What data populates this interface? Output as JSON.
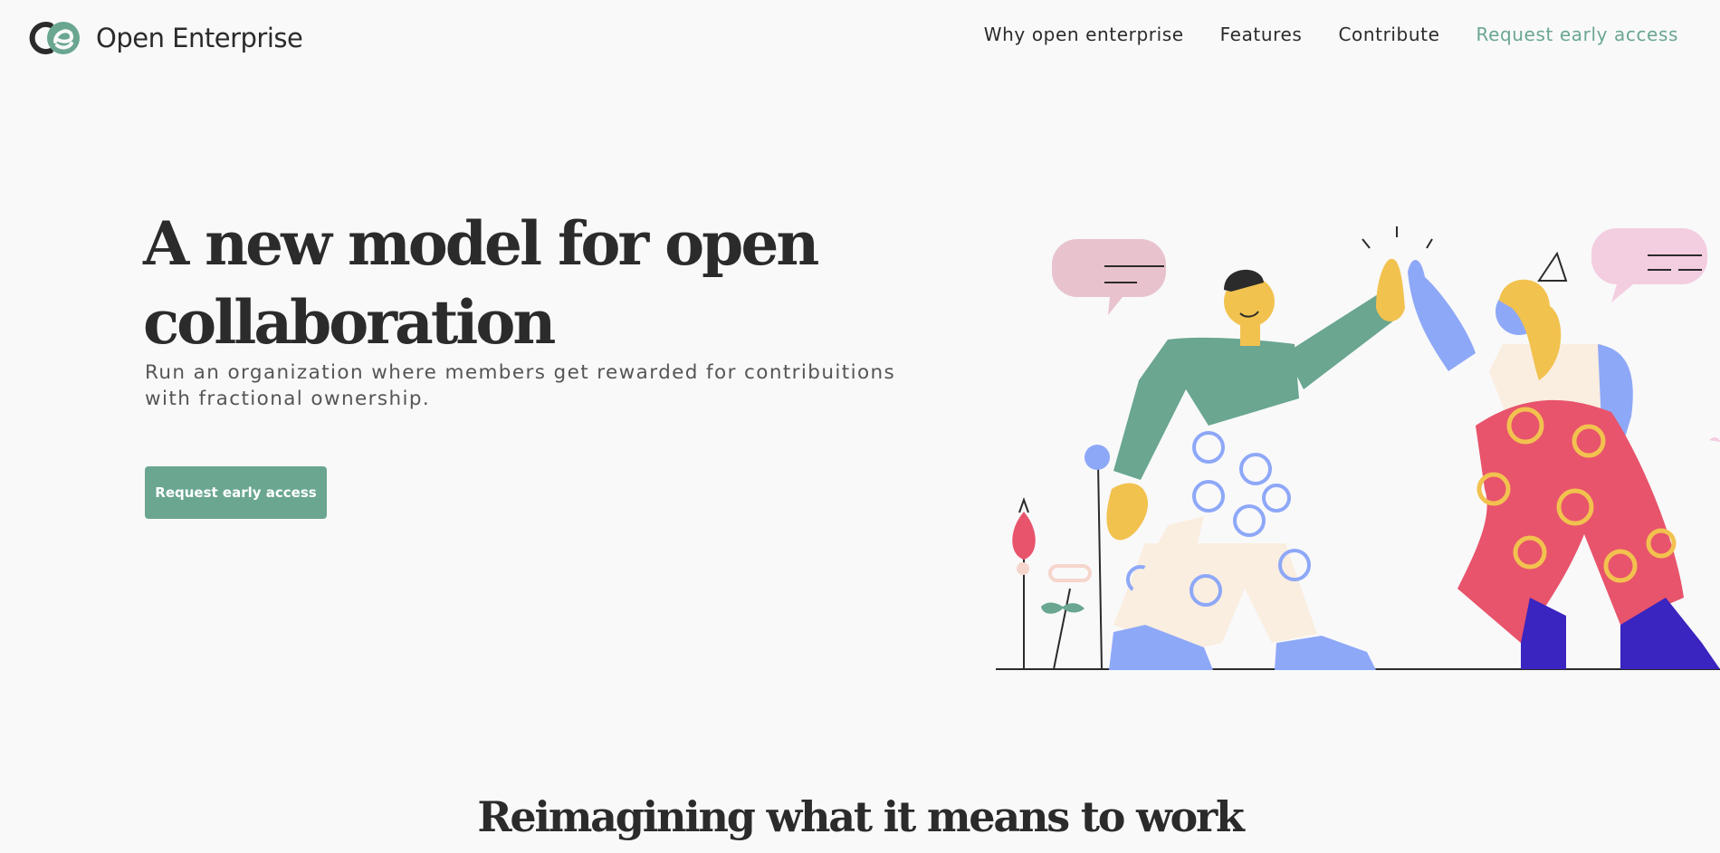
{
  "brand": {
    "name": "Open Enterprise",
    "logo_icon": "oe-logo-icon"
  },
  "nav": {
    "items": [
      {
        "label": "Why open enterprise"
      },
      {
        "label": "Features"
      },
      {
        "label": "Contribute"
      },
      {
        "label": "Request early access"
      }
    ]
  },
  "hero": {
    "title": "A new model for open collaboration",
    "subtitle": "Run an organization where members get rewarded for contribuitions with fractional ownership.",
    "cta_label": "Request early access"
  },
  "section": {
    "title": "Reimagining what it means to work"
  },
  "colors": {
    "accent": "#6aa690",
    "text": "#2b2b2b",
    "background": "#f9f9fa",
    "button_text": "#ffffff"
  }
}
